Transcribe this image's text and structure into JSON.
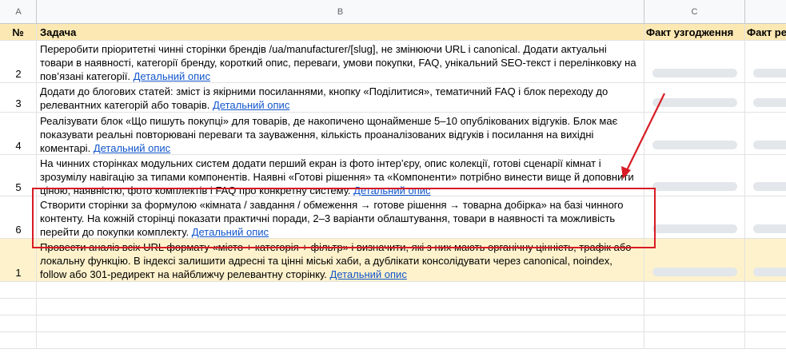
{
  "columns": [
    "A",
    "B",
    "C"
  ],
  "header": {
    "num": "№",
    "task": "Задача",
    "fact_agreement": "Факт узгодження",
    "fact_realization": "Факт ре"
  },
  "rows": [
    {
      "num": "2",
      "text": "Переробити пріоритетні чинні сторінки брендів /ua/manufacturer/[slug], не змінюючи URL і canonical. Додати актуальні товари в наявності, категорії бренду, короткий опис, переваги, умови покупки, FAQ, унікальний SEO-текст і перелінковку на пов’язані категорії.",
      "link": "Детальний опис"
    },
    {
      "num": "3",
      "text": "Додати до блогових статей: зміст із якірними посиланнями, кнопку «Поділитися», тематичний FAQ і блок переходу до релевантних категорій або товарів.",
      "link": "Детальний опис"
    },
    {
      "num": "4",
      "text": "Реалізувати блок «Що пишуть покупці» для товарів, де накопичено щонайменше 5–10 опублікованих відгуків. Блок має показувати реальні повторювані переваги та зауваження, кількість проаналізованих відгуків і посилання на вихідні коментарі.",
      "link": "Детальний опис"
    },
    {
      "num": "5",
      "text": "На чинних сторінках модульних систем додати перший екран із фото інтер’єру, опис колекції, готові сценарії кімнат і зрозумілу навігацію за типами компонентів. Наявні «Готові рішення» та «Компоненти» потрібно винести вище й доповнити ціною, наявністю, фото комплектів і FAQ про конкретну систему.",
      "link": "Детальний опис"
    },
    {
      "num": "6",
      "text": "Створити сторінки за формулою «кімната / завдання / обмеження → готове рішення → товарна добірка» на базі чинного контенту. На кожній сторінці показати практичні поради, 2–3 варіанти облаштування, товари в наявності та можливість перейти до покупки комплекту.",
      "link": "Детальний опис"
    },
    {
      "num": "1",
      "text": "Провести аналіз всіх URL формату «місто + категорія + фільтр» і визначити, які з них мають органічну цінність, трафік або локальну функцію. В індексі залишити адресні та цінні міські хаби, а дублікати консолідувати через canonical, noindex, follow або 301-редирект на найближчу релевантну сторінку.",
      "link": "Детальний опис"
    }
  ],
  "colors": {
    "header_bg": "#fce8b2",
    "highlight_row_bg": "#fef2cc",
    "link": "#1155cc",
    "annotation_red": "#d81b24"
  }
}
